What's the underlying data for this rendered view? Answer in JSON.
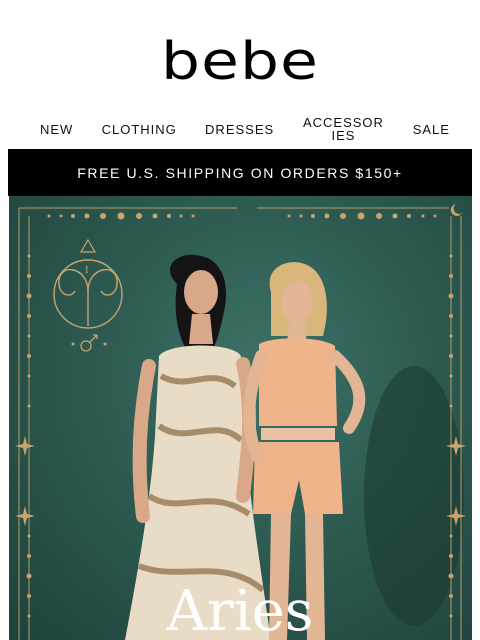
{
  "brand": {
    "logo_text": "bebe"
  },
  "nav": {
    "items": [
      {
        "label": "NEW"
      },
      {
        "label": "CLOTHING"
      },
      {
        "label": "DRESSES"
      },
      {
        "label": "ACCESSORIES"
      },
      {
        "label": "SALE"
      }
    ]
  },
  "promo_banner": {
    "text": "FREE U.S. SHIPPING ON ORDERS $150+"
  },
  "hero": {
    "title": "Aries",
    "icons": [
      "aries-ram-glyph-icon",
      "triangle-icon",
      "mars-symbol-icon",
      "crescent-moon-icon",
      "sparkle-star-icon"
    ],
    "colors": {
      "background": "#2d5b52",
      "ornament": "#c9a46e"
    }
  }
}
